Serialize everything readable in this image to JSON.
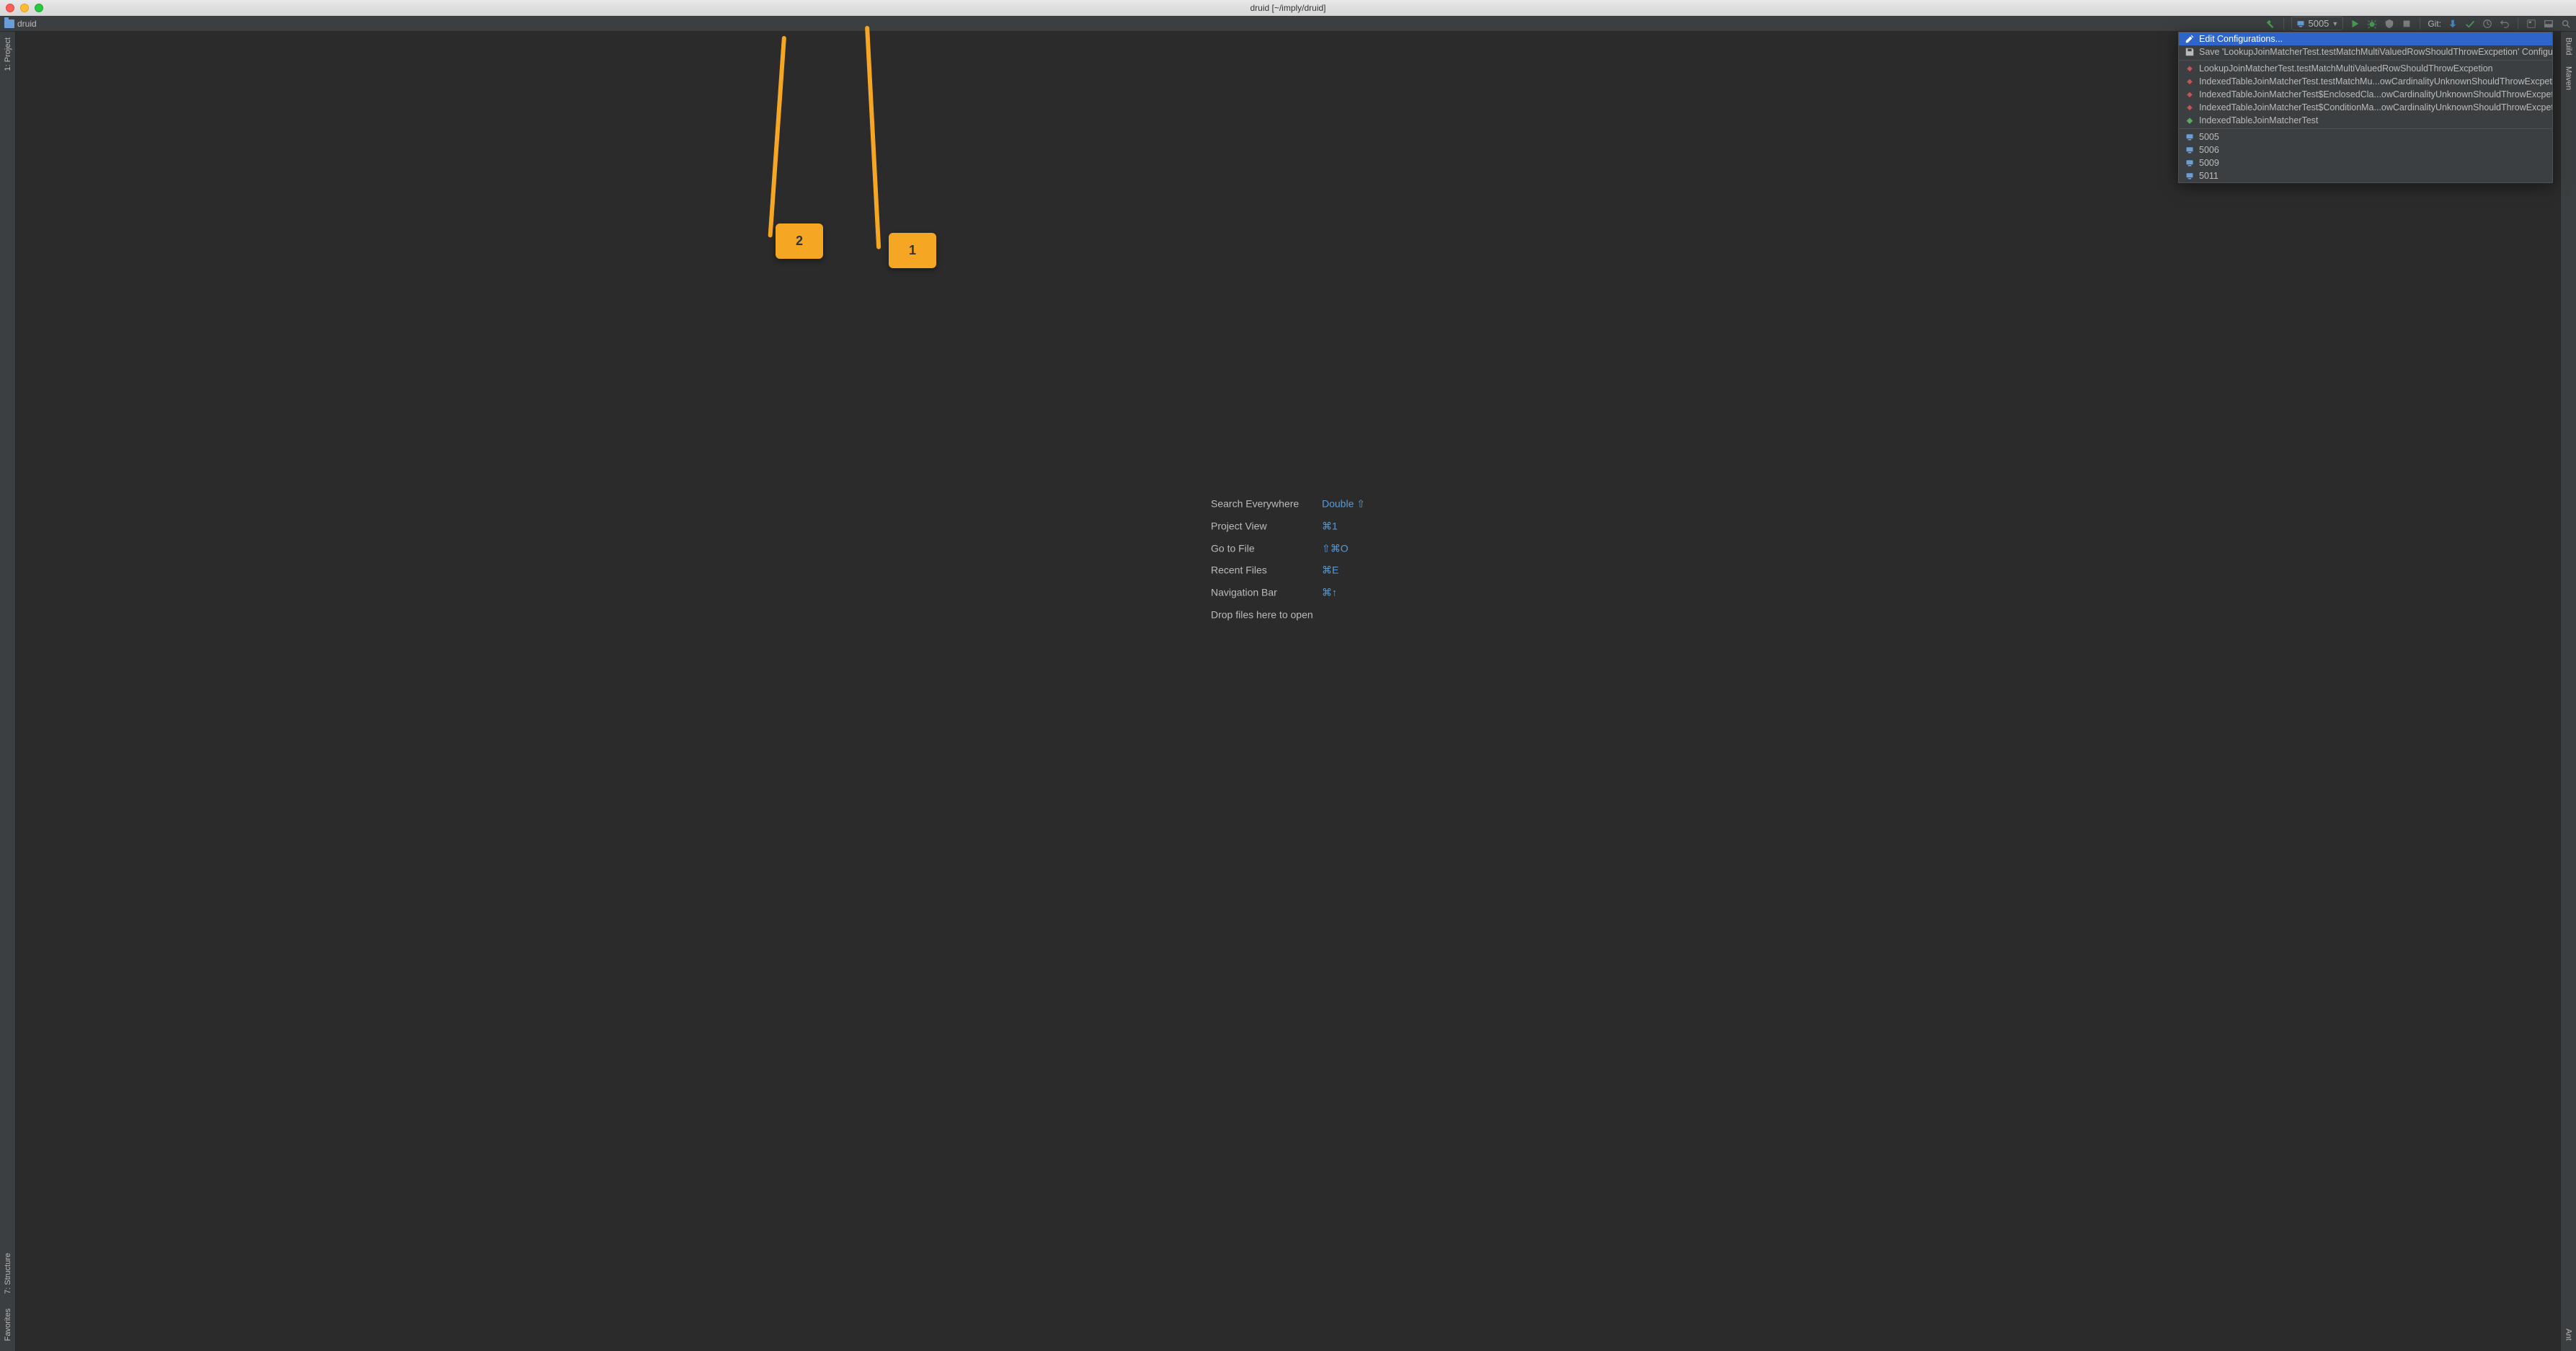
{
  "title": "druid [~/imply/druid]",
  "navbar": {
    "project": "druid"
  },
  "toolbar": {
    "run_config_selected": "5005",
    "git_label": "Git:"
  },
  "left_gutter": {
    "project": "1: Project",
    "structure": "7: Structure",
    "favorites": "Favorites"
  },
  "right_gutter": {
    "build": "Build",
    "maven": "Maven",
    "ant": "Ant"
  },
  "hints": [
    {
      "label": "Search Everywhere",
      "shortcut": "Double ⇧"
    },
    {
      "label": "Project View",
      "shortcut": "⌘1"
    },
    {
      "label": "Go to File",
      "shortcut": "⇧⌘O"
    },
    {
      "label": "Recent Files",
      "shortcut": "⌘E"
    },
    {
      "label": "Navigation Bar",
      "shortcut": "⌘↑"
    },
    {
      "label": "Drop files here to open",
      "shortcut": ""
    }
  ],
  "run_popup": {
    "edit": "Edit Configurations...",
    "save": "Save 'LookupJoinMatcherTest.testMatchMultiValuedRowShouldThrowExcpetion' Configuration",
    "tests": [
      "LookupJoinMatcherTest.testMatchMultiValuedRowShouldThrowExcpetion",
      "IndexedTableJoinMatcherTest.testMatchMu...owCardinalityUnknownShouldThrowExcpetion",
      "IndexedTableJoinMatcherTest$EnclosedCla...owCardinalityUnknownShouldThrowExcpetion",
      "IndexedTableJoinMatcherTest$ConditionMa...owCardinalityUnknownShouldThrowExcpetion",
      "IndexedTableJoinMatcherTest"
    ],
    "remotes": [
      "5005",
      "5006",
      "5009",
      "5011"
    ]
  },
  "callouts": {
    "one": "1",
    "two": "2"
  }
}
